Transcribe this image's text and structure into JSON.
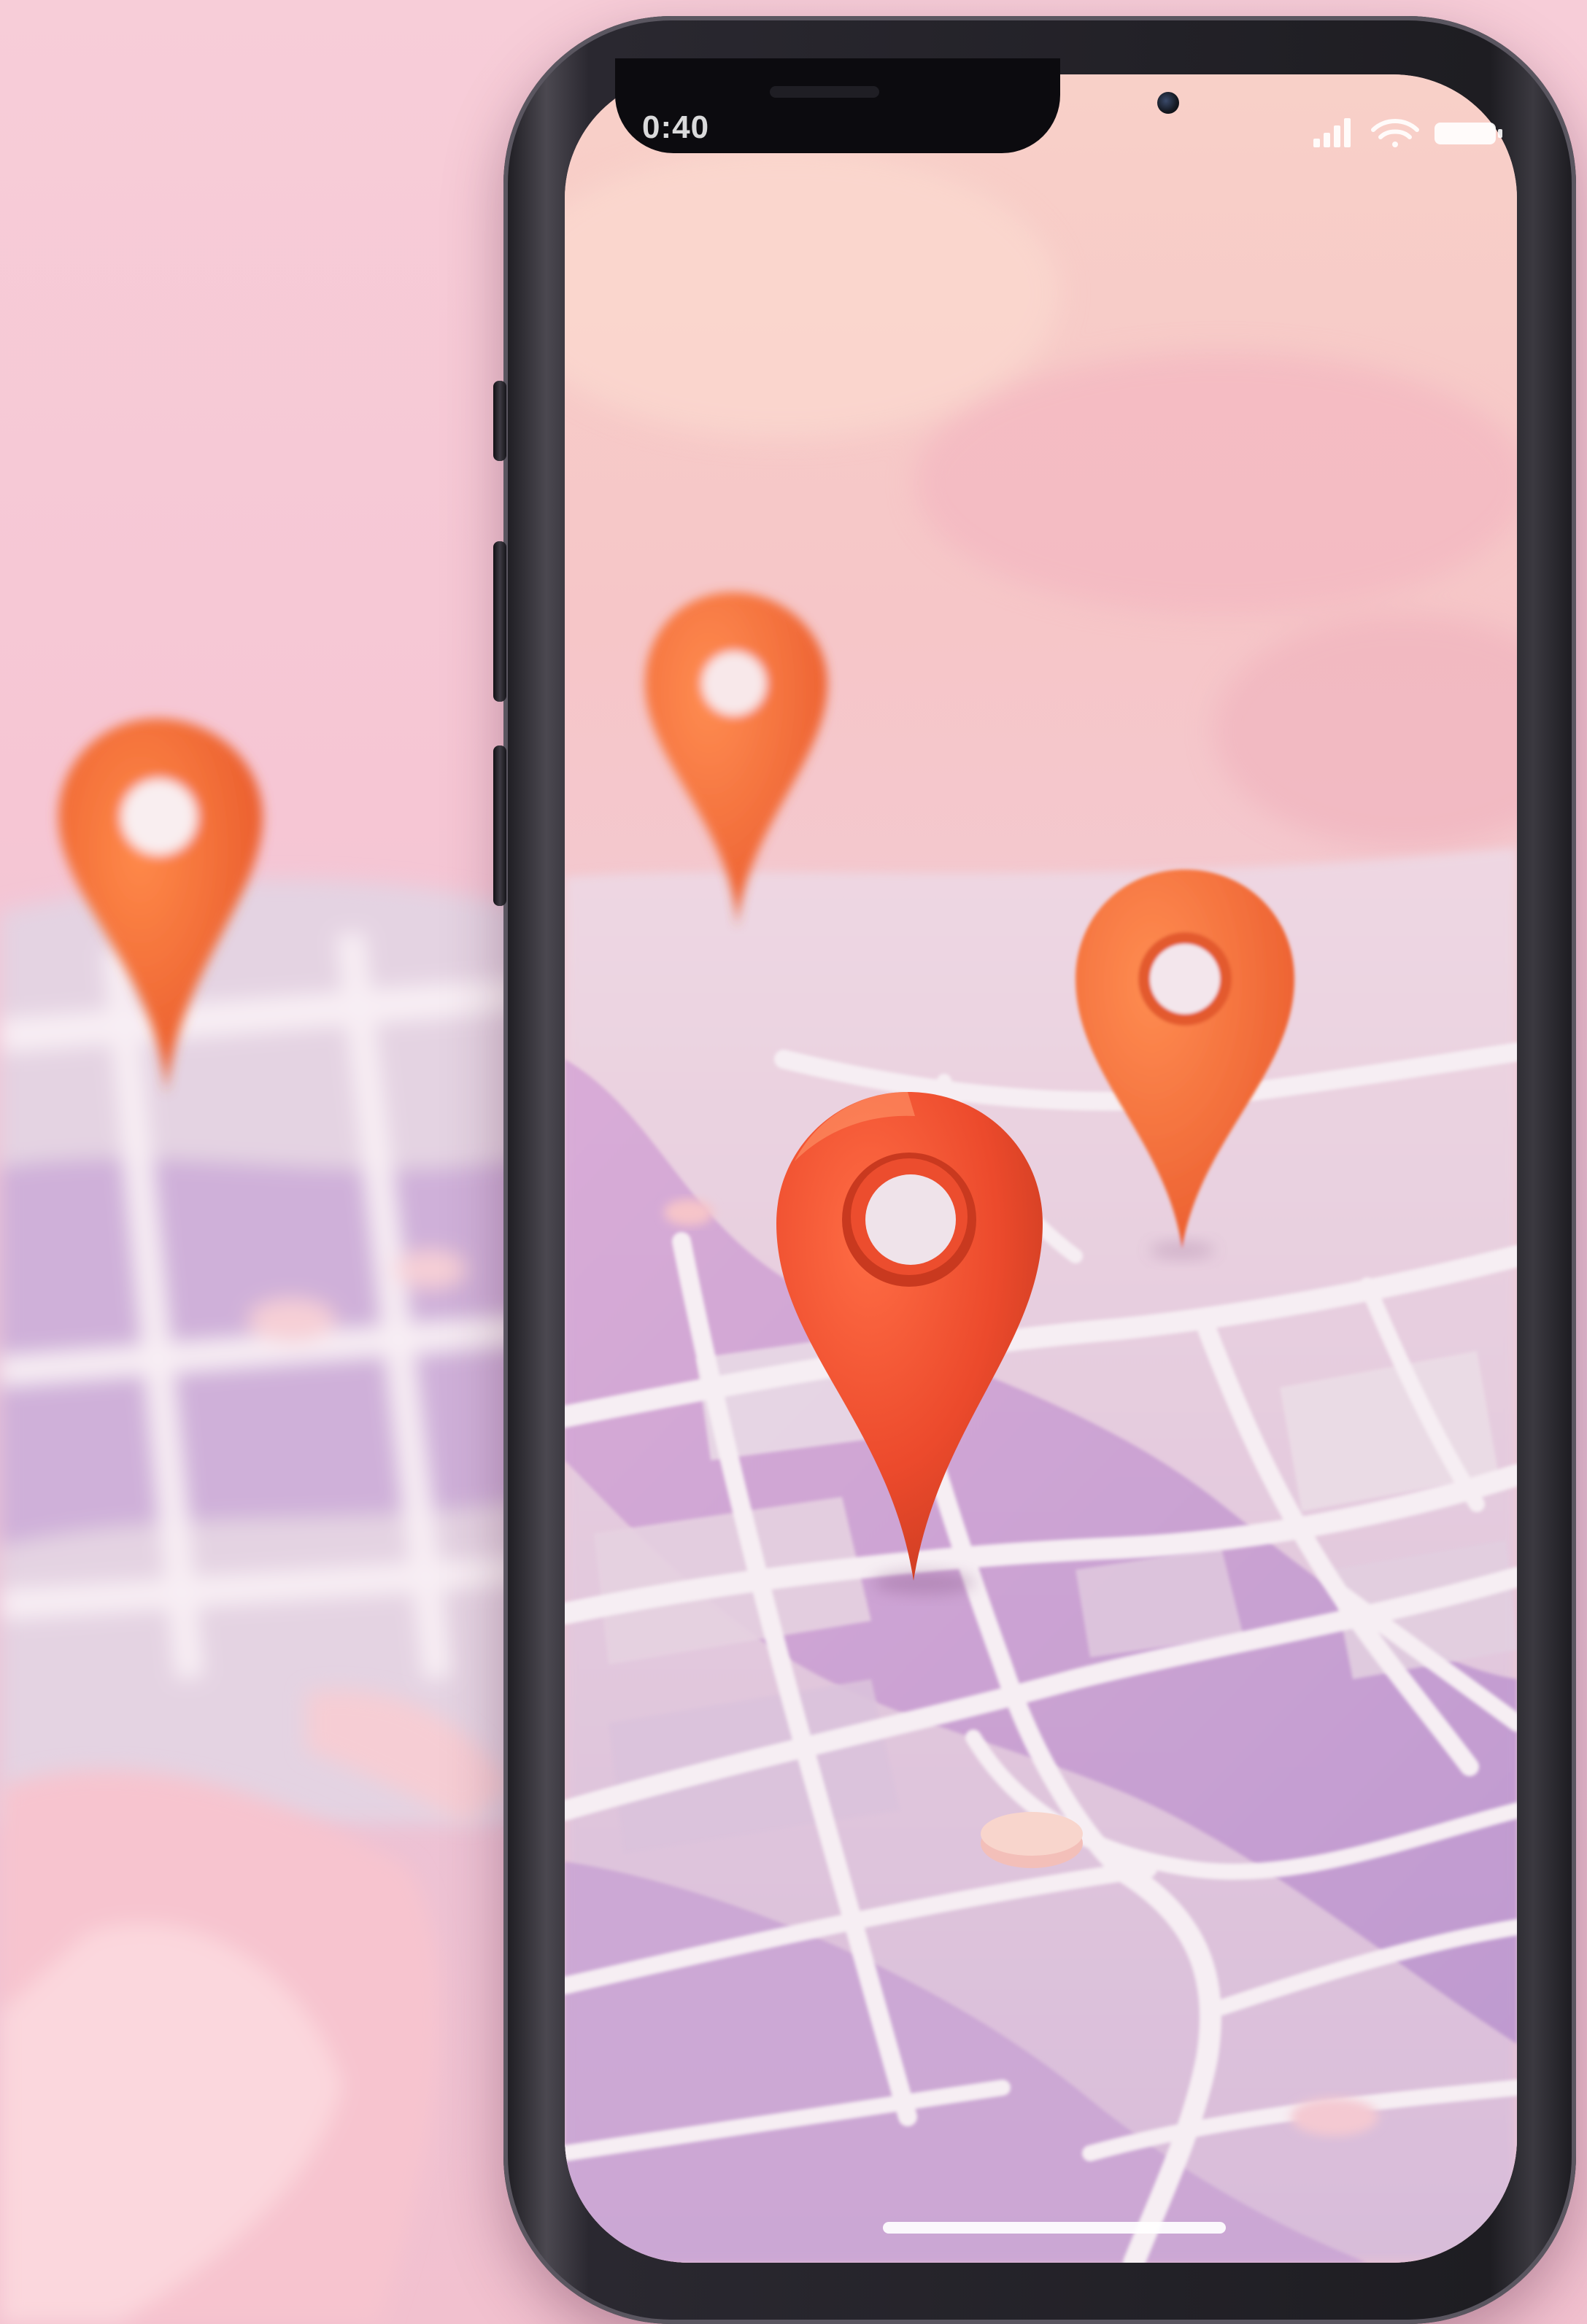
{
  "status_bar": {
    "time": "0:40"
  },
  "icons": {
    "signal": "cellular-signal-icon",
    "wifi": "wifi-icon",
    "battery": "battery-icon",
    "pins": [
      "map-pin-icon",
      "map-pin-icon",
      "map-pin-icon",
      "map-pin-icon"
    ]
  },
  "colors": {
    "background_pink": "#f6c7d2",
    "map_purple": "#c8a6d6",
    "road_white": "#f4eef2",
    "pin_orange": "#f06a32",
    "pin_red": "#e9472b",
    "phone_frame": "#1f1e23"
  }
}
